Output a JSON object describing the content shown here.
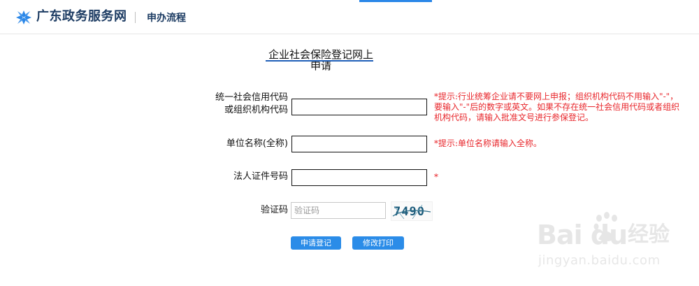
{
  "header": {
    "site_name": "广东政务服务网",
    "section": "申办流程",
    "logo_icon": "gd-gov-logo-icon",
    "accent_color": "#2b87e8"
  },
  "form": {
    "title": "企业社会保险登记网上申请",
    "fields": [
      {
        "label_line1": "统一社会信用代码",
        "label_line2": "或组织机构代码",
        "value": "",
        "hint": "*提示:行业统筹企业请不要网上申报；组织机构代码不用输入\"-\"，要输入\"-\"后的数字或英文。如果不存在统一社会信用代码或者组织机构代码，请输入批准文号进行参保登记。"
      },
      {
        "label": "单位名称(全称)",
        "value": "",
        "hint": "*提示:单位名称请输入全称。"
      },
      {
        "label": "法人证件号码",
        "value": "",
        "hint": "*"
      }
    ],
    "captcha": {
      "label": "验证码",
      "placeholder": "验证码",
      "image_text": "7490"
    },
    "buttons": {
      "submit": "申请登记",
      "print": "修改打印"
    },
    "button_color": "#2b8ce8",
    "hint_color": "#e8262b"
  },
  "watermark": {
    "brand": "Bai du",
    "cn": "经验",
    "url": "jingyan.baidu.com"
  }
}
